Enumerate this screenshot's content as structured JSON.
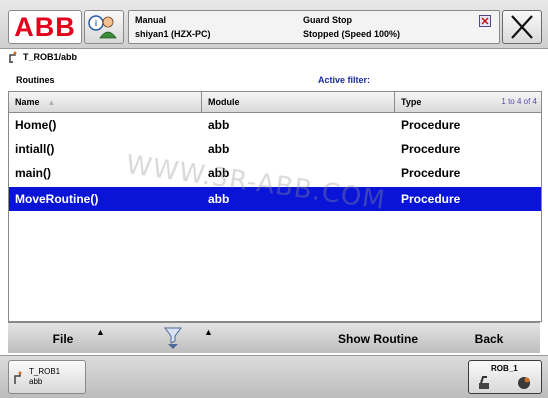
{
  "header": {
    "logo": "ABB",
    "mode": "Manual",
    "controller": "shiyan1 (HZX-PC)",
    "safety_state": "Guard Stop",
    "run_state": "Stopped (Speed 100%)",
    "quickset_icon": "quickset-person-icon",
    "close_icon": "close-x-icon"
  },
  "path": {
    "icon": "robot-task-icon",
    "text": "T_ROB1/abb"
  },
  "routines_panel": {
    "label": "Routines",
    "filter_label": "Active filter:",
    "range": "1 to 4 of 4"
  },
  "table": {
    "columns": [
      "Name",
      "Module",
      "Type"
    ],
    "rows": [
      {
        "name": "Home()",
        "module": "abb",
        "type": "Procedure",
        "selected": false
      },
      {
        "name": "intiall()",
        "module": "abb",
        "type": "Procedure",
        "selected": false
      },
      {
        "name": "main()",
        "module": "abb",
        "type": "Procedure",
        "selected": false
      },
      {
        "name": "MoveRoutine()",
        "module": "abb",
        "type": "Procedure",
        "selected": true
      }
    ],
    "selection_color": "#0a14d6"
  },
  "watermark": "WWW.3R-ABB.COM",
  "commands": {
    "file": "File",
    "show_routine": "Show Routine",
    "back": "Back",
    "filter_icon": "filter-funnel-icon"
  },
  "taskbar": {
    "task_line1": "T_ROB1",
    "task_line2": "abb",
    "rob_label": "ROB_1"
  }
}
